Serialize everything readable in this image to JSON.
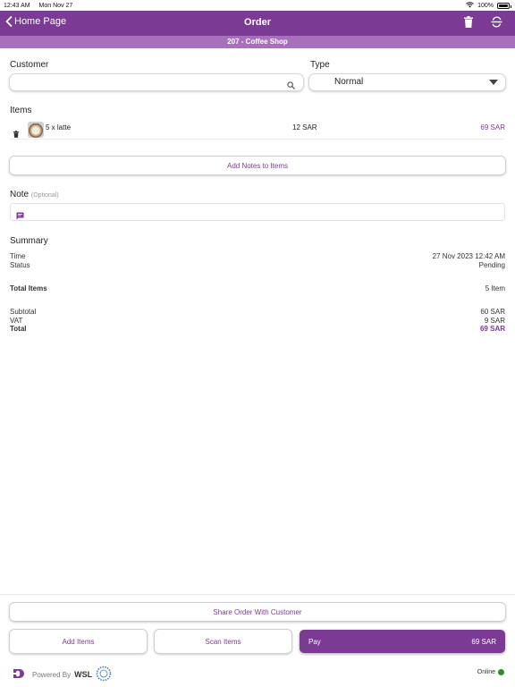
{
  "status_bar": {
    "time": "12:43 AM",
    "date": "Mon Nov 27",
    "battery": "100%",
    "battery_level": 1.0,
    "wifi_icon": "wifi-icon"
  },
  "nav": {
    "back_label": "Home Page",
    "title": "Order",
    "delete_icon": "trash-icon",
    "cancel_icon": "strike-circle-icon"
  },
  "subheader": {
    "text": "207 - Coffee Shop"
  },
  "customer": {
    "label": "Customer",
    "value": "",
    "placeholder": ""
  },
  "type": {
    "label": "Type",
    "value": "Normal"
  },
  "items": {
    "label": "Items",
    "rows": [
      {
        "name": "5 x latte",
        "unit_price": "12 SAR",
        "total": "69 SAR"
      }
    ],
    "add_notes_label": "Add Notes to Items"
  },
  "note": {
    "label": "Note",
    "optional": "(Optional)",
    "value": ""
  },
  "summary": {
    "label": "Summary",
    "time_label": "Time",
    "time_value": "27 Nov 2023 12:42 AM",
    "status_label": "Status",
    "status_value": "Pending",
    "total_items_label": "Total Items",
    "total_items_value": "5 Item",
    "subtotal_label": "Subtotal",
    "subtotal_value": "60 SAR",
    "vat_label": "VAT",
    "vat_value": "9 SAR",
    "total_label": "Total",
    "total_value": "69 SAR"
  },
  "actions": {
    "share_label": "Share Order With Customer",
    "add_items_label": "Add Items",
    "scan_items_label": "Scan Items",
    "pay_label": "Pay",
    "pay_amount": "69 SAR"
  },
  "footer": {
    "powered_by": "Powered By",
    "brand": "WSL",
    "online": "Online"
  },
  "colors": {
    "primary": "#7b3a94",
    "subheader": "#a86fbd",
    "online": "#2e8b2e"
  }
}
